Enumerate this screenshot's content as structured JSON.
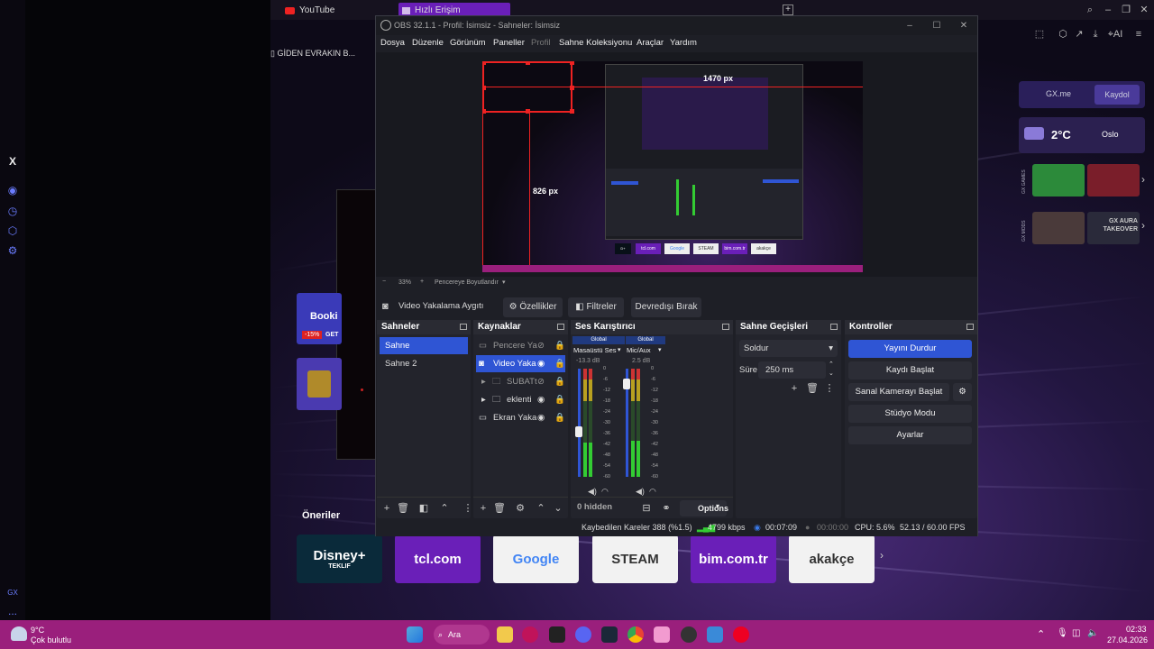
{
  "browser": {
    "tabs": [
      {
        "label": "YouTube"
      },
      {
        "label": "Hızlı Erişim"
      }
    ],
    "giden_label": "GİDEN EVRAKIN B...",
    "side_labels": {
      "x": "X",
      "gx": "GX",
      "more": "..."
    },
    "right_widgets": {
      "gxme": "GX.me",
      "kaydol": "Kaydol",
      "temp": "2°C",
      "city": "Oslo",
      "promo1": "GX GAMES",
      "promo2": "GX AURA TAKEOVER",
      "side_promo": "GX MODS",
      "top_ai": "AI"
    },
    "booking": {
      "label": "Booki",
      "discount": "-15%",
      "get": "GET"
    },
    "suggestions_title": "Öneriler",
    "suggestions": [
      {
        "label": "Disney+",
        "sub": "TEKLIF",
        "bg": "#0a2a3a",
        "fg": "#ffffff"
      },
      {
        "label": "tcl.com",
        "bg": "#6a1fb8",
        "fg": "#ffffff"
      },
      {
        "label": "Google",
        "bg": "#f2f2f2",
        "fg": "#4285f4"
      },
      {
        "label": "STEAM",
        "bg": "#f2f2f2",
        "fg": "#333333"
      },
      {
        "label": "bim.com.tr",
        "bg": "#6a1fb8",
        "fg": "#ffffff"
      },
      {
        "label": "akakçe",
        "bg": "#f2f2f2",
        "fg": "#333333"
      }
    ]
  },
  "obs": {
    "title": "OBS 32.1.1 - Profil: İsimsiz - Sahneler: İsimsiz",
    "menu": [
      "Dosya",
      "Düzenle",
      "Görünüm",
      "Paneller",
      "Profil",
      "Sahne Koleksiyonu",
      "Araçlar",
      "Yardım"
    ],
    "preview": {
      "width_label": "1470 px",
      "height_label": "826 px",
      "zoom": "33%",
      "fit_label": "Pencereye Boyutlandır",
      "minus": "−",
      "plus": "+"
    },
    "source_bar": {
      "name": "Video Yakalama Aygıtı",
      "properties": "Özellikler",
      "filters": "Filtreler",
      "deactivate": "Devredışı Bırak"
    },
    "scenes": {
      "title": "Sahneler",
      "items": [
        "Sahne",
        "Sahne 2"
      ]
    },
    "sources": {
      "title": "Kaynaklar",
      "items": [
        "Pencere Ya",
        "Video Yaka",
        "SUBATt",
        "eklenti",
        "Ekran Yaka"
      ]
    },
    "mixer": {
      "title": "Ses Karıştırıcı",
      "channels": [
        {
          "badge": "Global",
          "name": "Masaüstü Ses",
          "db": "-13.3 dB",
          "level": 0.42
        },
        {
          "badge": "Global",
          "name": "Mic/Aux",
          "db": "2.5 dB",
          "level": 0.86
        }
      ],
      "ticks": [
        "0",
        "-6",
        "-12",
        "-18",
        "-24",
        "-30",
        "-36",
        "-42",
        "-48",
        "-54",
        "-60"
      ],
      "hidden": "0 hidden",
      "options": "Options"
    },
    "transitions": {
      "title": "Sahne Geçişleri",
      "type": "Soldur",
      "duration_label": "Süre",
      "duration": "250 ms"
    },
    "controls": {
      "title": "Kontroller",
      "buttons": [
        "Yayını Durdur",
        "Kaydı Başlat",
        "Sanal Kamerayı Başlat",
        "Stüdyo Modu",
        "Ayarlar"
      ]
    },
    "status": {
      "dropped": "Kaybedilen Kareler 388 (%1.5)",
      "bitrate": "4799 kbps",
      "stream_time": "00:07:09",
      "rec_time": "00:00:00",
      "cpu": "CPU: 5.6%",
      "fps": "52.13 / 60.00 FPS"
    },
    "nested_preview_labels": [
      "tcl.com",
      "Google",
      "STEAM",
      "bim.com.tr",
      "akakçe"
    ]
  },
  "taskbar": {
    "temp": "9°C",
    "weather": "Çok bulutlu",
    "search": "Ara",
    "time": "02:33",
    "date": "27.04.2026"
  }
}
